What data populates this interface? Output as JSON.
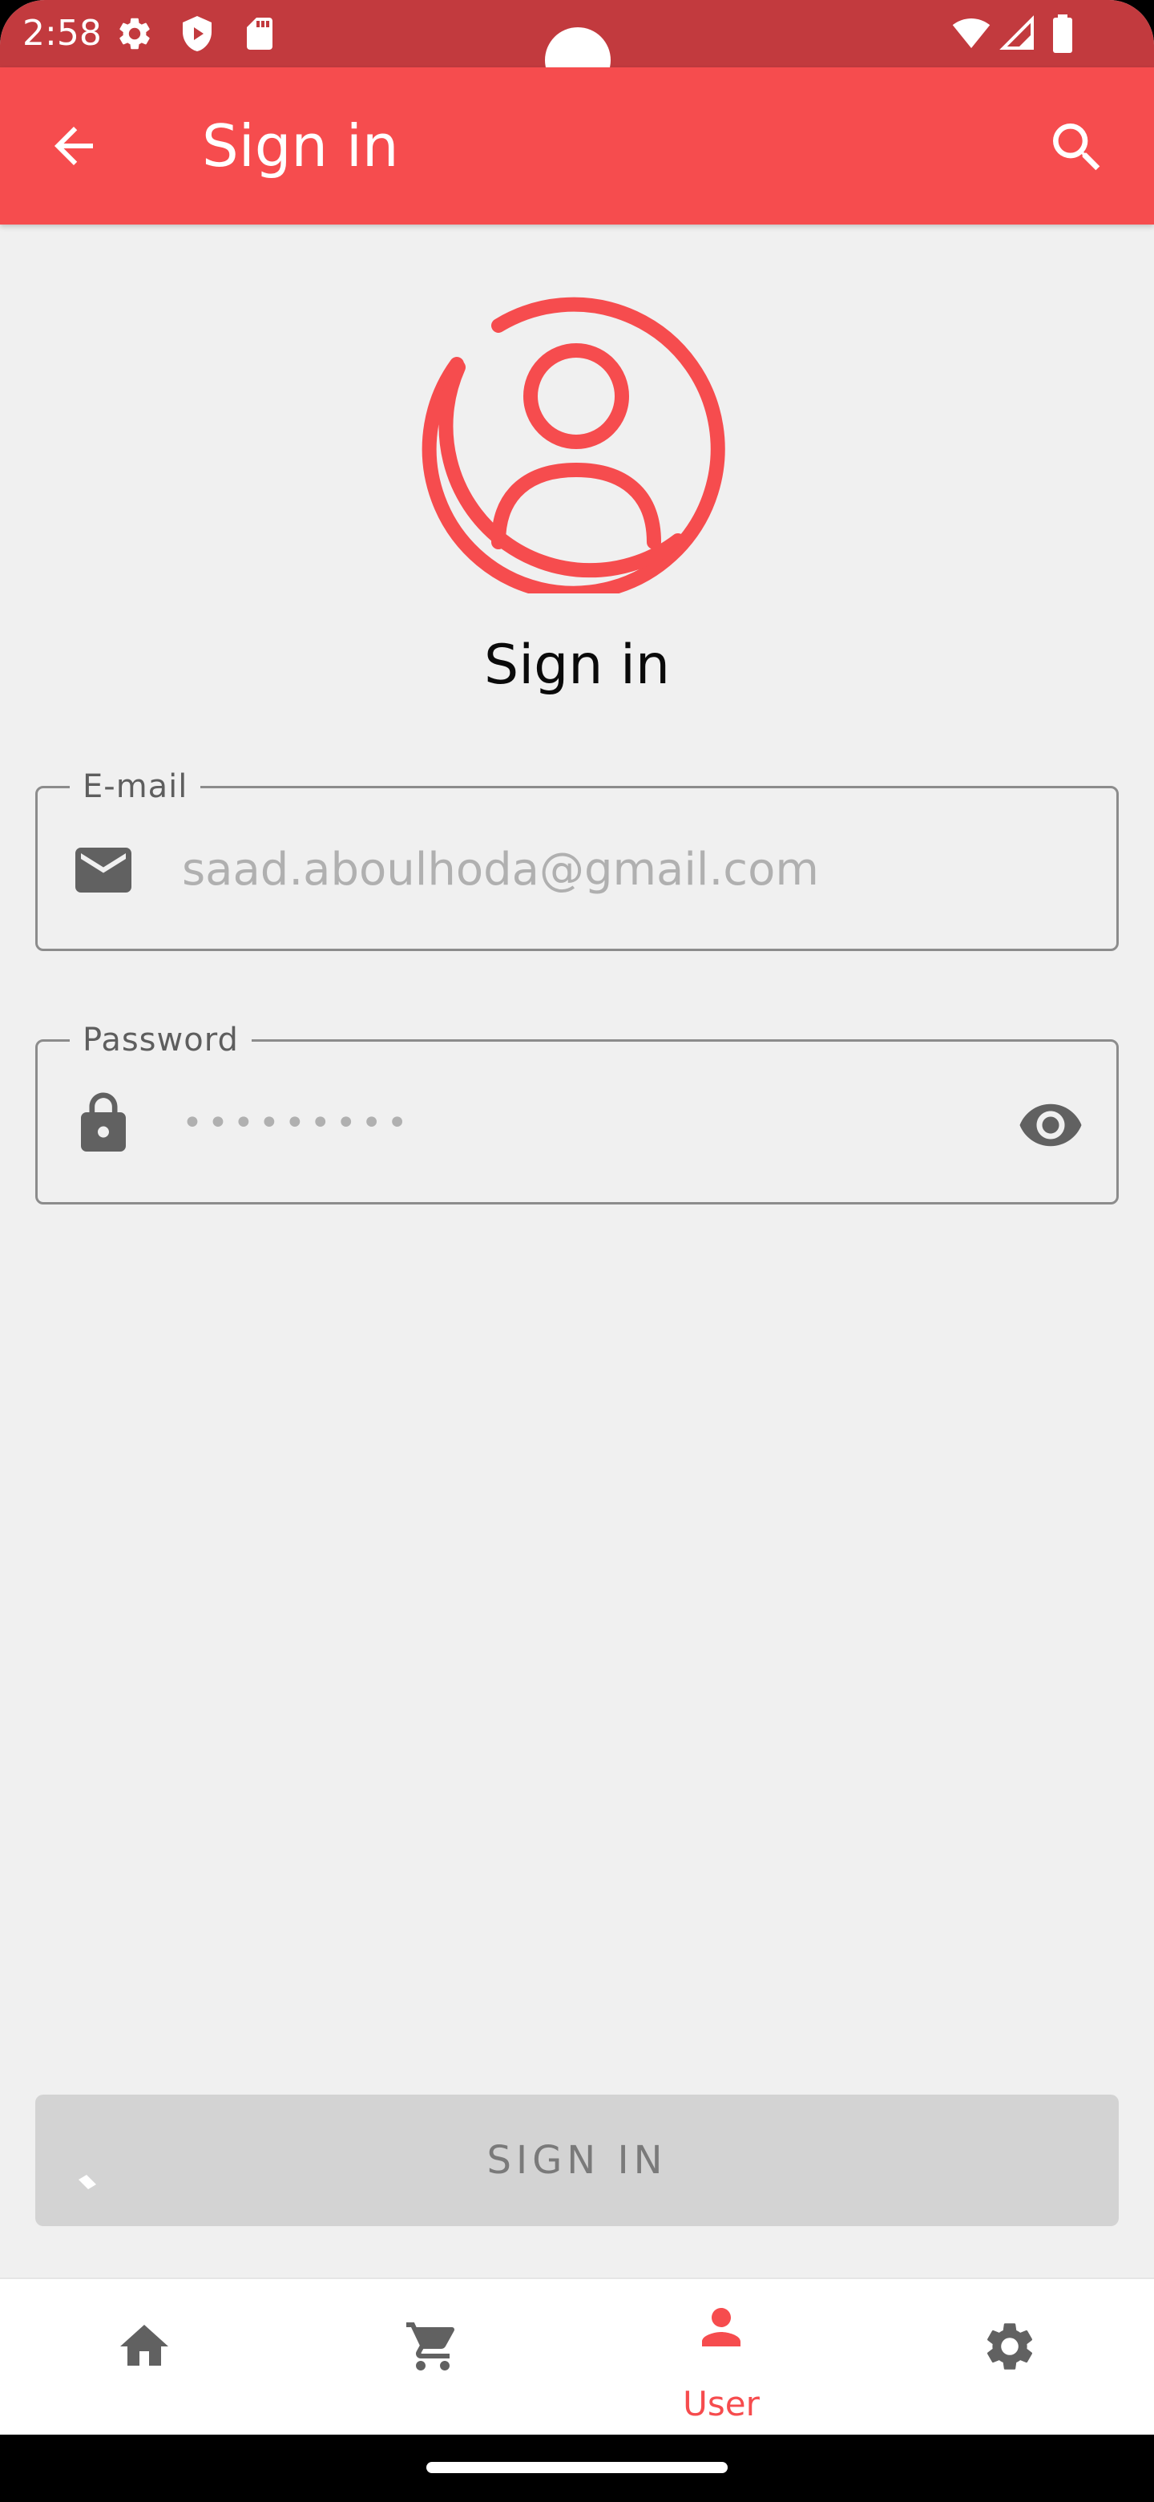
{
  "status_bar": {
    "time": "2:58",
    "icons": [
      "settings-gear-icon",
      "shield-play-icon",
      "sd-card-icon",
      "wifi-icon",
      "signal-icon",
      "battery-icon"
    ],
    "color": "#c23a3e"
  },
  "app_bar": {
    "title": "Sign in",
    "back_icon": "arrow-back-icon",
    "search_icon": "search-icon",
    "color": "#f64c4e"
  },
  "page": {
    "heading": "Sign in",
    "avatar_icon": "account-circle-icon"
  },
  "form": {
    "email": {
      "label": "E-mail",
      "placeholder": "saad.aboulhoda@gmail.com",
      "icon": "mail-icon"
    },
    "password": {
      "label": "Password",
      "value": "•••••••••",
      "icon": "lock-icon",
      "toggle_icon": "eye-icon"
    },
    "submit_label": "SIGN IN"
  },
  "bottom_nav": {
    "items": [
      {
        "icon": "home-icon",
        "label": ""
      },
      {
        "icon": "cart-icon",
        "label": ""
      },
      {
        "icon": "user-icon",
        "label": "User",
        "active": true
      },
      {
        "icon": "settings-icon",
        "label": ""
      }
    ],
    "active_color": "#f64c4e",
    "inactive_color": "#616161"
  }
}
